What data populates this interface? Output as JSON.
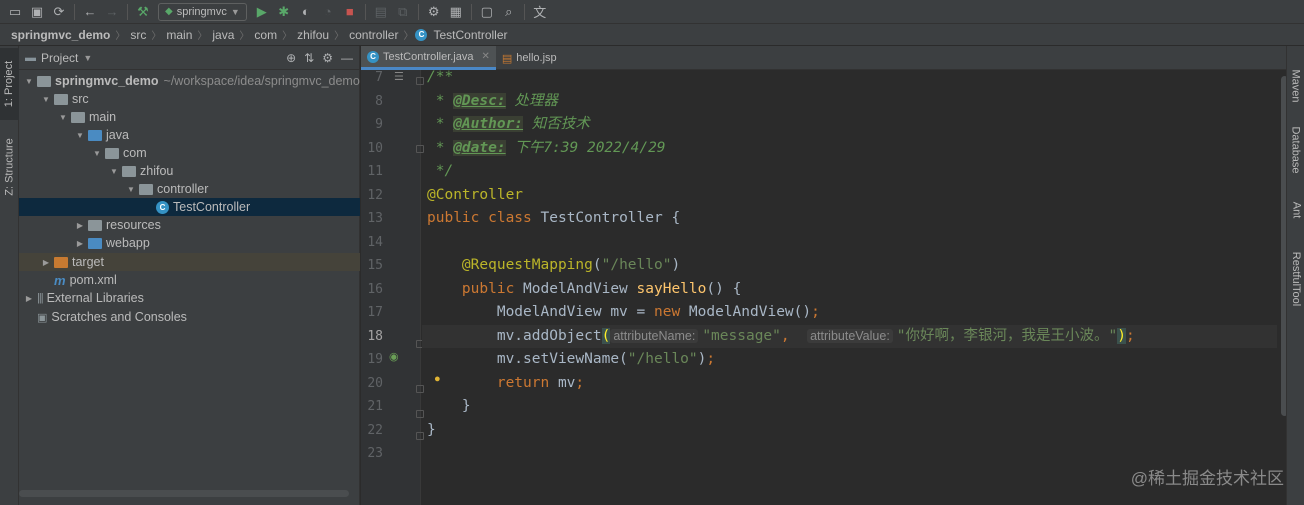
{
  "toolbar": {
    "icons": [
      "open-folder-icon",
      "save-icon",
      "sync-icon",
      "back-icon",
      "forward-icon",
      "build-hammer-icon"
    ],
    "run_config": "springmvc",
    "run_icons": [
      "run-icon",
      "debug-icon",
      "coverage-icon",
      "profile-icon",
      "stop-icon"
    ],
    "tool_icons": [
      "vcs-icon",
      "attach-icon",
      "wrench-icon",
      "project-structure-icon",
      "frame-icon",
      "search-icon",
      "translate-icon"
    ]
  },
  "breadcrumb": [
    "springmvc_demo",
    "src",
    "main",
    "java",
    "com",
    "zhifou",
    "controller",
    "TestController"
  ],
  "left_strip": {
    "project_tab": "1: Project",
    "structure_tab": "Z: Structure"
  },
  "project": {
    "title": "Project",
    "tree": [
      {
        "label": "springmvc_demo",
        "hint": "~/workspace/idea/springmvc_demo",
        "depth": 0,
        "arrow": "▼",
        "icon": "gray",
        "bold": true
      },
      {
        "label": "src",
        "depth": 1,
        "arrow": "▼",
        "icon": "gray"
      },
      {
        "label": "main",
        "depth": 2,
        "arrow": "▼",
        "icon": "gray"
      },
      {
        "label": "java",
        "depth": 3,
        "arrow": "▼",
        "icon": "blue"
      },
      {
        "label": "com",
        "depth": 4,
        "arrow": "▼",
        "icon": "gray"
      },
      {
        "label": "zhifou",
        "depth": 5,
        "arrow": "▼",
        "icon": "gray"
      },
      {
        "label": "controller",
        "depth": 6,
        "arrow": "▼",
        "icon": "gray"
      },
      {
        "label": "TestController",
        "depth": 7,
        "arrow": "",
        "icon": "class",
        "selected": true
      },
      {
        "label": "resources",
        "depth": 3,
        "arrow": "▶",
        "icon": "gray"
      },
      {
        "label": "webapp",
        "depth": 3,
        "arrow": "▶",
        "icon": "blue"
      },
      {
        "label": "target",
        "depth": 1,
        "arrow": "▶",
        "icon": "orange",
        "excluded": true
      },
      {
        "label": "pom.xml",
        "depth": 1,
        "arrow": "",
        "icon": "maven"
      },
      {
        "label": "External Libraries",
        "depth": 0,
        "arrow": "▶",
        "icon": "lib"
      },
      {
        "label": "Scratches and Consoles",
        "depth": 0,
        "arrow": "",
        "icon": "scratch"
      }
    ]
  },
  "tabs": [
    {
      "label": "TestController.java",
      "type": "class",
      "active": true
    },
    {
      "label": "hello.jsp",
      "type": "jsp",
      "active": false
    }
  ],
  "code": {
    "current_line": 18,
    "lines": [
      {
        "n": 7,
        "html": "<span class=\"c-doc\">/**</span>"
      },
      {
        "n": 8,
        "html": "<span class=\"c-doc\"> * </span><span class=\"c-tag\">@Desc:</span><span class=\"c-doc\"> 处理器</span>"
      },
      {
        "n": 9,
        "html": "<span class=\"c-doc\"> * </span><span class=\"c-tag\">@Author:</span><span class=\"c-doc\"> 知否技术</span>"
      },
      {
        "n": 10,
        "html": "<span class=\"c-doc\"> * </span><span class=\"c-tag\">@date:</span><span class=\"c-doc\"> 下午7:39 2022/4/29</span>"
      },
      {
        "n": 11,
        "html": "<span class=\"c-doc\"> */</span>"
      },
      {
        "n": 12,
        "html": "<span class=\"c-ann\">@Controller</span>"
      },
      {
        "n": 13,
        "html": "<span class=\"c-kw\">public class </span>TestController {"
      },
      {
        "n": 14,
        "html": ""
      },
      {
        "n": 15,
        "html": "    <span class=\"c-ann\">@RequestMapping</span>(<span class=\"c-str\">\"/hello\"</span>)"
      },
      {
        "n": 16,
        "html": "    <span class=\"c-kw\">public </span>ModelAndView <span class=\"c-fn\">sayHello</span>() {"
      },
      {
        "n": 17,
        "html": "        ModelAndView mv = <span class=\"c-kw\">new </span>ModelAndView()<span class=\"c-kw\">;</span>"
      },
      {
        "n": 18,
        "html": "        mv.addObject<span class=\"c-paren-hl\">(</span><span class=\"c-hint\">attributeName:</span><span class=\"c-str\">\"message\"</span><span class=\"c-kw\">,  </span><span class=\"c-hint\">attributeValue:</span><span class=\"c-str\">\"你好啊，李银河，我是王小波。\"</span><span class=\"c-paren-hl\">)</span><span class=\"c-kw\">;</span>"
      },
      {
        "n": 19,
        "html": "        mv.setViewName(<span class=\"c-str\">\"/hello\"</span>)<span class=\"c-kw\">;</span>"
      },
      {
        "n": 20,
        "html": "        <span class=\"c-kw\">return </span>mv<span class=\"c-kw\">;</span>"
      },
      {
        "n": 21,
        "html": "    }"
      },
      {
        "n": 22,
        "html": "}"
      },
      {
        "n": 23,
        "html": ""
      }
    ]
  },
  "right_strip": {
    "maven": "Maven",
    "database": "Database",
    "ant": "Ant",
    "restful": "RestfulTool"
  },
  "watermark": "@稀土掘金技术社区"
}
